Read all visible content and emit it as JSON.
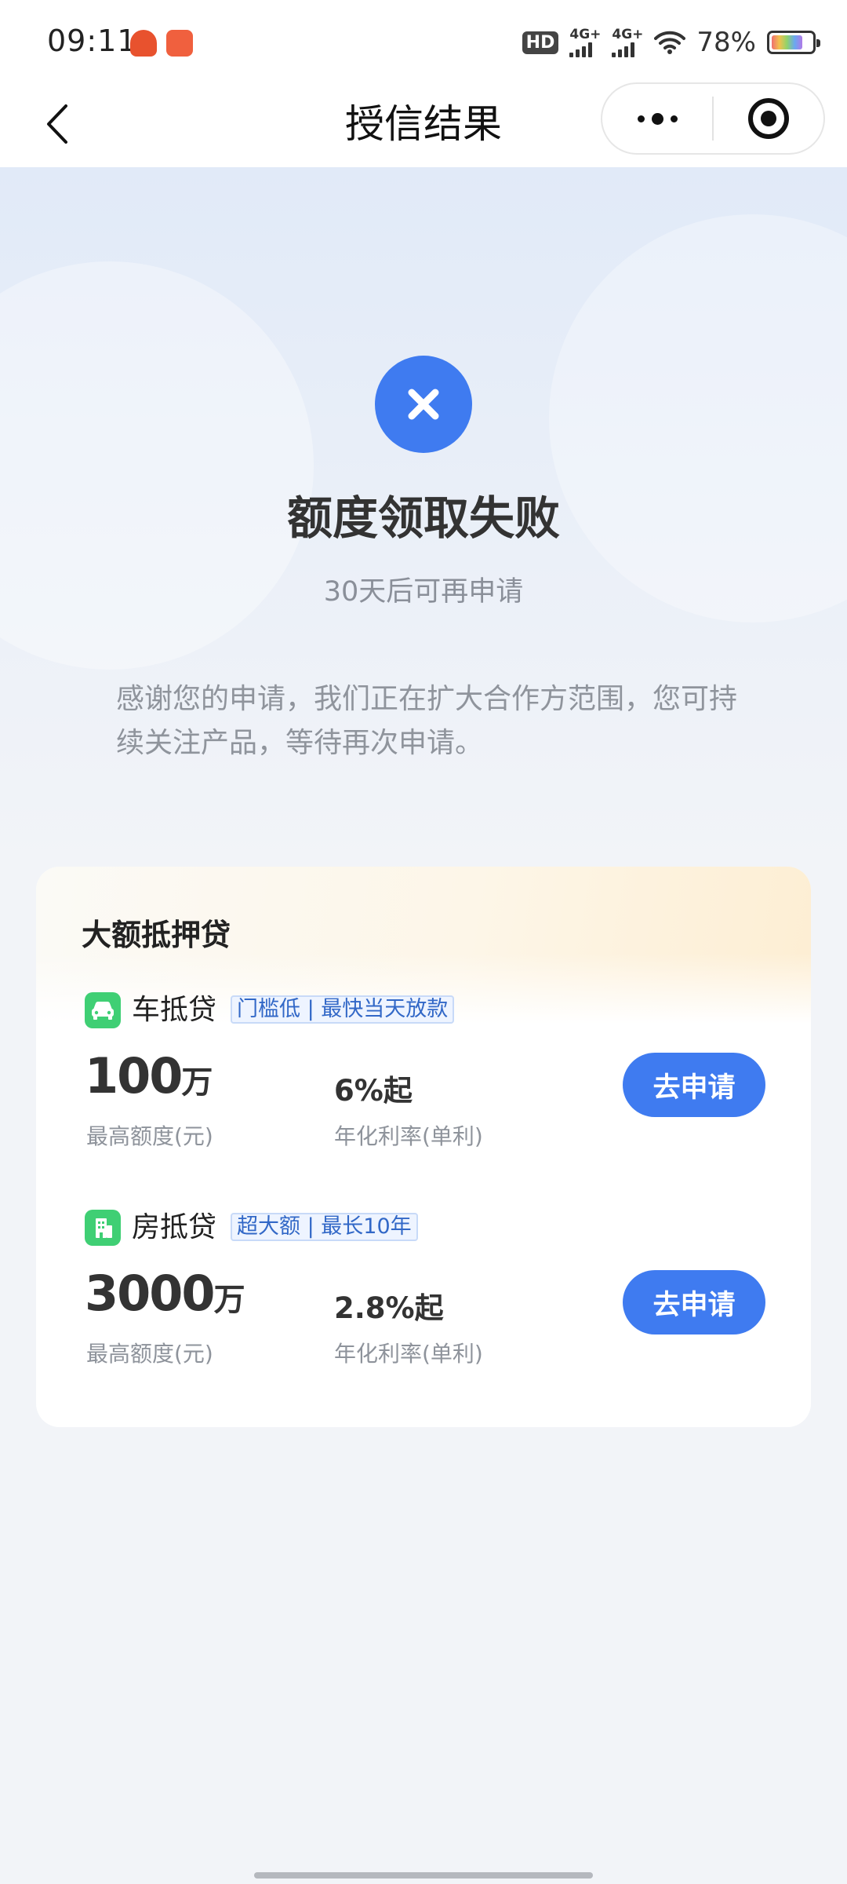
{
  "status_bar": {
    "time": "09:11",
    "hd_label": "HD",
    "sim1_label": "4G+",
    "sim2_label": "4G+",
    "battery_percent": "78%",
    "battery_level": 0.78
  },
  "nav": {
    "title": "授信结果"
  },
  "result": {
    "title": "额度领取失败",
    "subtitle": "30天后可再申请",
    "description": "感谢您的申请，我们正在扩大合作方范围，您可持续关注产品，等待再次申请。",
    "status_color": "#3f7bf0"
  },
  "card": {
    "title": "大额抵押贷",
    "loans": [
      {
        "name": "车抵贷",
        "tag": "门槛低 | 最快当天放款",
        "amount": "100",
        "amount_unit": "万",
        "amount_label": "最高额度(元)",
        "rate": "6%起",
        "rate_label": "年化利率(单利)",
        "button": "去申请",
        "icon": "car-icon"
      },
      {
        "name": "房抵贷",
        "tag": "超大额 | 最长10年",
        "amount": "3000",
        "amount_unit": "万",
        "amount_label": "最高额度(元)",
        "rate": "2.8%起",
        "rate_label": "年化利率(单利)",
        "button": "去申请",
        "icon": "building-icon"
      }
    ]
  },
  "colors": {
    "accent": "#3f7bf0",
    "loan_icon": "#3fcf74"
  }
}
